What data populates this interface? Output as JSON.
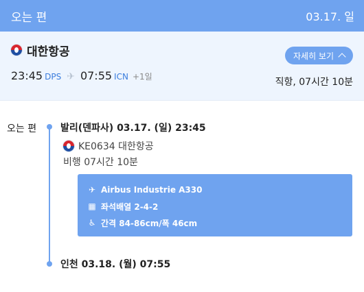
{
  "header": {
    "title": "오는 편",
    "date": "03.17. 일"
  },
  "summary": {
    "airline": "대한항공",
    "detail_button": "자세히 보기",
    "dep_time": "23:45",
    "dep_code": "DPS",
    "arr_time": "07:55",
    "arr_code": "ICN",
    "day_offset": "+1일",
    "duration": "직항, 07시간 10분"
  },
  "timeline": {
    "label": "오는 편",
    "departure": "발리(덴파사) 03.17. (일) 23:45",
    "flight": "KE0634 대한항공",
    "flight_duration": "비행 07시간 10분",
    "aircraft": "Airbus Industrie A330",
    "seat_config": "좌석배열 2-4-2",
    "seat_pitch": "간격 84-86cm/폭 46cm",
    "arrival": "인천 03.18. (월) 07:55"
  },
  "icons": {
    "plane": "airplane-icon",
    "seat": "grid-icon",
    "pitch": "wheelchair-icon"
  },
  "colors": {
    "accent": "#6fa3ef",
    "code": "#3b7ddd",
    "summary_bg": "#eef5fe"
  }
}
